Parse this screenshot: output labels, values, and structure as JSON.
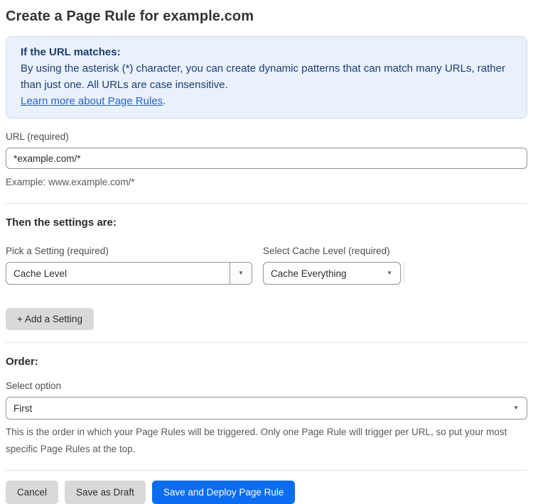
{
  "page": {
    "title": "Create a Page Rule for example.com"
  },
  "info_box": {
    "heading": "If the URL matches:",
    "body": "By using the asterisk (*) character, you can create dynamic patterns that can match many URLs, rather than just one. All URLs are case insensitive.",
    "link_text": "Learn more about Page Rules",
    "link_suffix": "."
  },
  "url_field": {
    "label": "URL (required)",
    "value": "*example.com/*",
    "helper": "Example: www.example.com/*"
  },
  "settings_section": {
    "heading": "Then the settings are:",
    "setting_picker": {
      "label": "Pick a Setting (required)",
      "value": "Cache Level"
    },
    "cache_level_picker": {
      "label": "Select Cache Level (required)",
      "value": "Cache Everything"
    },
    "add_setting_button": "+ Add a Setting"
  },
  "order_section": {
    "heading": "Order:",
    "label": "Select option",
    "value": "First",
    "helper": "This is the order in which your Page Rules will be triggered. Only one Page Rule will trigger per URL, so put your most specific Page Rules at the top."
  },
  "footer": {
    "cancel_label": "Cancel",
    "save_draft_label": "Save as Draft",
    "save_deploy_label": "Save and Deploy Page Rule"
  },
  "icons": {
    "dropdown_arrow": "▼"
  },
  "colors": {
    "info_box_bg": "#e8f1fc",
    "info_box_border": "#c9ddf4",
    "info_box_text": "#1d3d6f",
    "link": "#2c62c9",
    "primary_button": "#0b6cf0",
    "gray_button": "#d9d9d9",
    "input_border": "#929292",
    "divider": "#e3e3e3",
    "helper_text": "#595959"
  }
}
